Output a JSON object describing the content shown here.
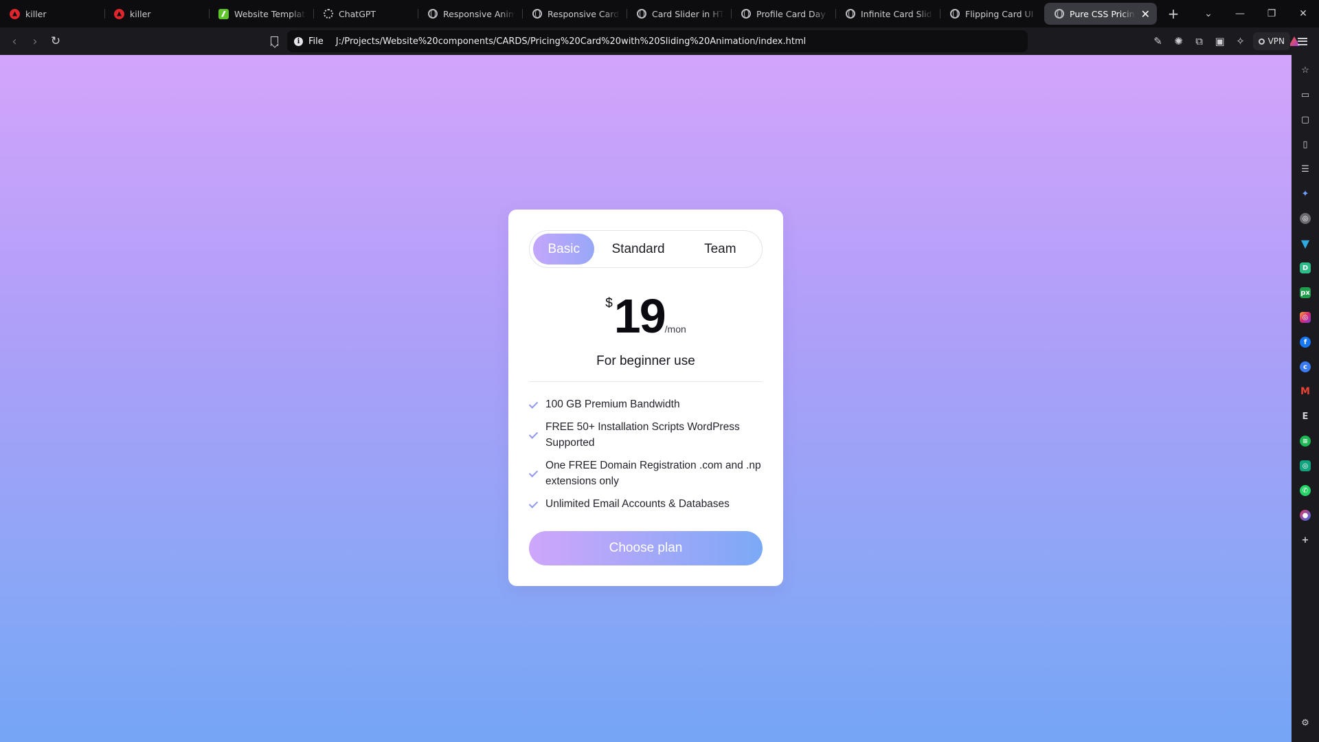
{
  "browser": {
    "tabs": [
      {
        "title": "killer",
        "icon": "brave-icon"
      },
      {
        "title": "killer",
        "icon": "brave-icon"
      },
      {
        "title": "Website Templates",
        "icon": "website-templates-icon"
      },
      {
        "title": "ChatGPT",
        "icon": "chatgpt-icon"
      },
      {
        "title": "Responsive Animat",
        "icon": "globe-icon"
      },
      {
        "title": "Responsive Card De",
        "icon": "globe-icon"
      },
      {
        "title": "Card Slider in HTML",
        "icon": "globe-icon"
      },
      {
        "title": "Profile Card Day Ni",
        "icon": "globe-icon"
      },
      {
        "title": "Infinite Card Slider",
        "icon": "globe-icon"
      },
      {
        "title": "Flipping Card UI De",
        "icon": "globe-icon"
      },
      {
        "title": "Pure CSS Pricin",
        "icon": "globe-icon",
        "active": true
      }
    ],
    "address": {
      "scheme_label": "File",
      "url": "J:/Projects/Website%20components/CARDS/Pricing%20Card%20with%20Sliding%20Animation/index.html"
    },
    "vpn_label": "VPN",
    "sidebar_icons": [
      "star-icon",
      "video-icon",
      "wallet-icon",
      "bookmarks-icon",
      "reading-list-icon",
      "leo-ai-icon",
      "app-icon",
      "app-icon",
      "app-icon",
      "app-icon",
      "instagram-icon",
      "facebook-icon",
      "app-icon",
      "gmail-icon",
      "app-icon",
      "spotify-icon",
      "app-icon",
      "whatsapp-icon",
      "app-icon",
      "add-icon"
    ],
    "sidebar_letter": "E"
  },
  "pricing_card": {
    "plans": [
      "Basic",
      "Standard",
      "Team"
    ],
    "active_plan": "Basic",
    "currency": "$",
    "price": "19",
    "period": "/mon",
    "tagline": "For beginner use",
    "features": [
      "100 GB Premium Bandwidth",
      "FREE 50+ Installation Scripts WordPress Supported",
      "One FREE Domain Registration .com and .np extensions only",
      "Unlimited Email Accounts & Databases"
    ],
    "cta_label": "Choose plan"
  },
  "colors": {
    "background_top": "#d3a4fb",
    "background_bottom": "#75a5f6",
    "accent_gradient_start": "#c3a6fb",
    "accent_gradient_end": "#98a7f7",
    "check_color": "#8f97ef"
  }
}
